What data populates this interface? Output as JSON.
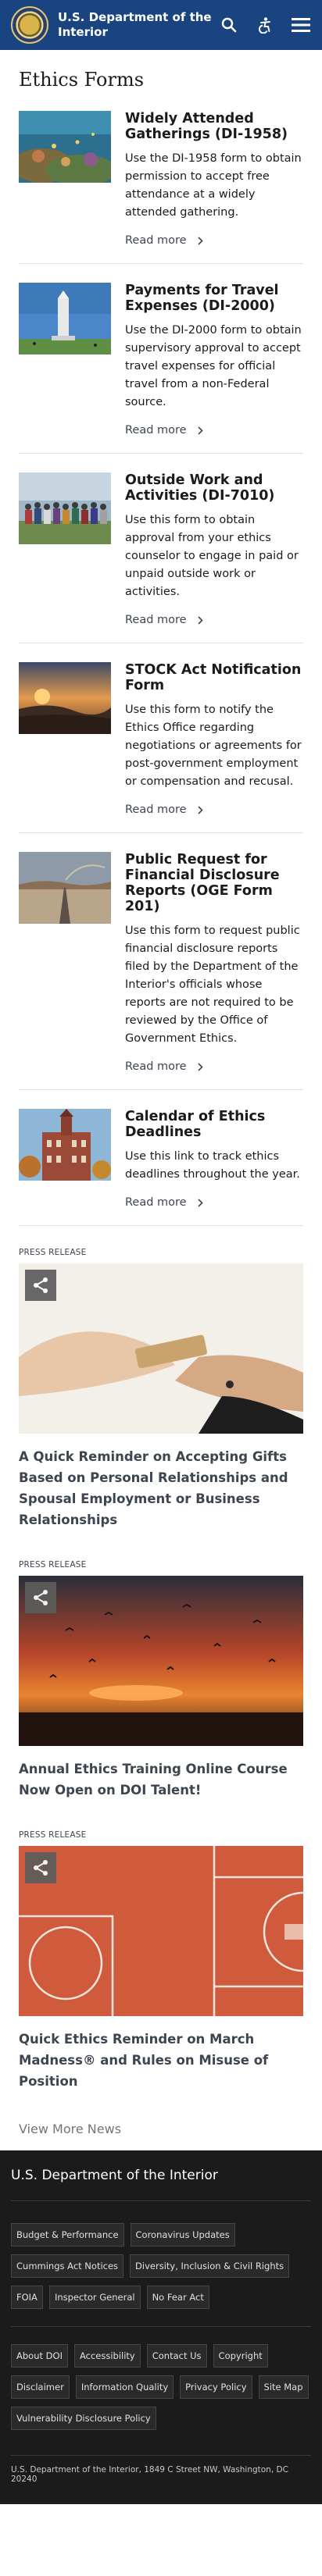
{
  "header": {
    "site_title": "U.S. Department of the Interior",
    "icons": [
      "seal-logo",
      "search-icon",
      "accessibility-icon",
      "menu-icon"
    ]
  },
  "page": {
    "title": "Ethics Forms"
  },
  "forms": [
    {
      "title": "Widely Attended Gatherings (DI-1958)",
      "description": "Use the DI-1958 form to obtain permission to accept free attendance at a widely attended gathering.",
      "read_more": "Read more"
    },
    {
      "title": "Payments for Travel Expenses (DI-2000)",
      "description": "Use the DI-2000 form to obtain supervisory approval to accept travel expenses for official travel from a non-Federal source.",
      "read_more": "Read more"
    },
    {
      "title": "Outside Work and Activities (DI-7010)",
      "description": "Use this form to obtain approval from your ethics counselor to engage in paid or unpaid outside work or activities.",
      "read_more": "Read more"
    },
    {
      "title": "STOCK Act Notification Form",
      "description": "Use this form to notify the Ethics Office regarding negotiations or agreements for post-government employment or compensation and recusal.",
      "read_more": "Read more"
    },
    {
      "title": "Public Request for Financial Disclosure Reports (OGE Form 201)",
      "description": "Use this form to request public financial disclosure reports filed by the Department of the Interior's officials whose reports are not required to be reviewed by the Office of Government Ethics.",
      "read_more": "Read more"
    },
    {
      "title": "Calendar of Ethics Deadlines",
      "description": "Use this link to track ethics deadlines throughout the year.",
      "read_more": "Read more"
    }
  ],
  "news": [
    {
      "kicker": "PRESS RELEASE",
      "title": "A Quick Reminder on Accepting Gifts Based on Personal Relationships and Spousal Employment or Business Relationships"
    },
    {
      "kicker": "PRESS RELEASE",
      "title": "Annual Ethics Training Online Course Now Open on DOI Talent!"
    },
    {
      "kicker": "PRESS RELEASE",
      "title": "Quick Ethics Reminder on March Madness® and Rules on Misuse of Position"
    }
  ],
  "view_more": "View More News",
  "footer": {
    "title": "U.S. Department of the Interior",
    "links_primary": [
      "Budget & Performance",
      "Coronavirus Updates",
      "Cummings Act Notices",
      "Diversity, Inclusion & Civil Rights",
      "FOIA",
      "Inspector General",
      "No Fear Act"
    ],
    "links_secondary": [
      "About DOI",
      "Accessibility",
      "Contact Us",
      "Copyright",
      "Disclaimer",
      "Information Quality",
      "Privacy Policy",
      "Site Map",
      "Vulnerability Disclosure Policy"
    ],
    "address": "U.S. Department of the Interior, 1849 C Street NW, Washington, DC 20240"
  },
  "colors": {
    "header_bg": "#1a4480",
    "footer_bg": "#1b1b1b",
    "text": "#1b1b1b"
  }
}
